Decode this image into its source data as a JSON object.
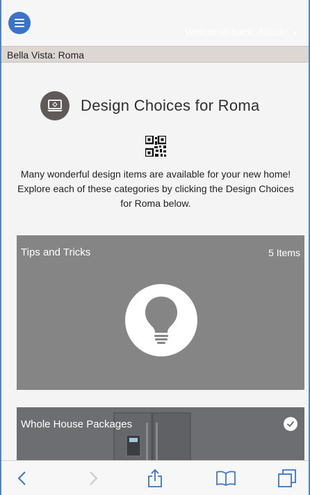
{
  "header": {
    "menu_icon": "hamburger-menu-icon",
    "welcome": "Welcome back, Nicole"
  },
  "breadcrumb": "Bella Vista: Roma",
  "page": {
    "title": "Design Choices for Roma",
    "title_icon": "laptop-icon",
    "intro": "Many wonderful design items are available for your new home!  Explore each of these categories by clicking the Design Choices for Roma below."
  },
  "cards": [
    {
      "title": "Tips and Tricks",
      "count": "5 Items",
      "icon": "lightbulb-icon"
    },
    {
      "title": "Whole House Packages",
      "icon": "checkmark-icon"
    }
  ],
  "toolbar": {
    "icons": [
      "back-icon",
      "forward-icon",
      "share-icon",
      "bookmarks-icon",
      "tabs-icon"
    ]
  },
  "colors": {
    "accent": "#3b73c6",
    "card_bg": "#858585",
    "breadcrumb_bg": "#ddd7d3",
    "toolbar_icon": "#3b73c6"
  }
}
